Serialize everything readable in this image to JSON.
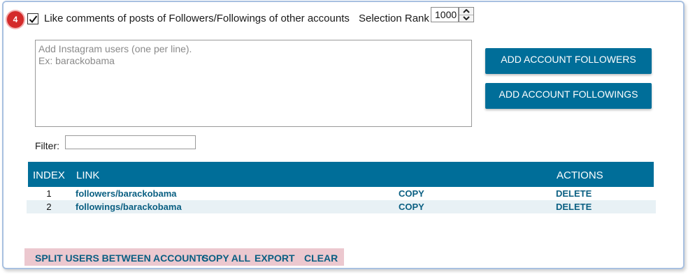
{
  "step_badge": "4",
  "option": {
    "checked": true,
    "label": "Like comments of posts of Followers/Followings of other accounts"
  },
  "selection_rank": {
    "label": "Selection Rank",
    "value": "1000"
  },
  "users_input": {
    "placeholder": "Add Instagram users (one per line).\nEx: barackobama"
  },
  "buttons": {
    "add_followers": "ADD ACCOUNT FOLLOWERS",
    "add_followings": "ADD ACCOUNT FOLLOWINGS"
  },
  "filter": {
    "label": "Filter:",
    "value": ""
  },
  "table": {
    "headers": {
      "index": "INDEX",
      "link": "LINK",
      "actions": "ACTIONS"
    },
    "rows": [
      {
        "index": "1",
        "link": "followers/barackobama",
        "copy": "COPY",
        "delete": "DELETE"
      },
      {
        "index": "2",
        "link": "followings/barackobama",
        "copy": "COPY",
        "delete": "DELETE"
      }
    ]
  },
  "footer": {
    "split": "SPLIT USERS BETWEEN ACCOUNTS",
    "copy_all": "COPY ALL",
    "export": "EXPORT",
    "clear": "CLEAR"
  },
  "colors": {
    "accent_blue": "#006e99",
    "link_blue": "#0a5f82",
    "badge_red": "#d42b2b",
    "footer_pink": "#ecc8cf",
    "row_alt": "#e8f1f5"
  },
  "icons": [
    "checkmark-icon",
    "spin-up-arrow-icon",
    "spin-down-arrow-icon"
  ]
}
